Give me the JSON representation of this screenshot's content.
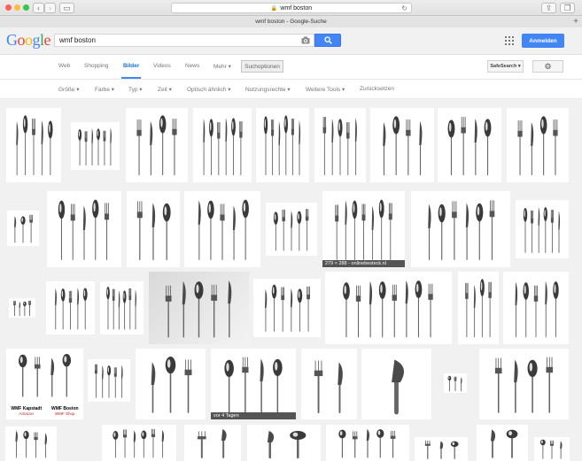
{
  "browser": {
    "url": "wmf boston",
    "tab_title": "wmf boston - Google-Suche"
  },
  "header": {
    "logo": "Google",
    "logo_colors": [
      "#4285f4",
      "#ea4335",
      "#fbbc05",
      "#4285f4",
      "#34a853",
      "#ea4335"
    ],
    "query": "wmf boston",
    "signin_label": "Anmelden"
  },
  "tabs": {
    "items": [
      {
        "label": "Web",
        "active": false
      },
      {
        "label": "Shopping",
        "active": false
      },
      {
        "label": "Bilder",
        "active": true
      },
      {
        "label": "Videos",
        "active": false
      },
      {
        "label": "News",
        "active": false
      },
      {
        "label": "Mehr ▾",
        "active": false
      }
    ],
    "search_options": "Suchoptionen",
    "safesearch": "SafeSearch ▾"
  },
  "tools": [
    "Größe ▾",
    "Farbe ▾",
    "Typ ▾",
    "Zeit ▾",
    "Optisch ähnlich ▾",
    "Nutzungsrechte ▾",
    "Weitere Tools ▾",
    "Zurücksetzen"
  ],
  "results": {
    "hover_caption": "279 × 288 - onlinebesteck.nl",
    "date_caption": "vor 4 Tagen",
    "brand_labels": [
      {
        "name": "WMF Kapstadt",
        "shop": "Amazon"
      },
      {
        "name": "WMF Boston",
        "shop": "WMF Shop"
      }
    ]
  },
  "colors": {
    "accent": "#4285f4",
    "toolbar": "#f1f1f1"
  }
}
